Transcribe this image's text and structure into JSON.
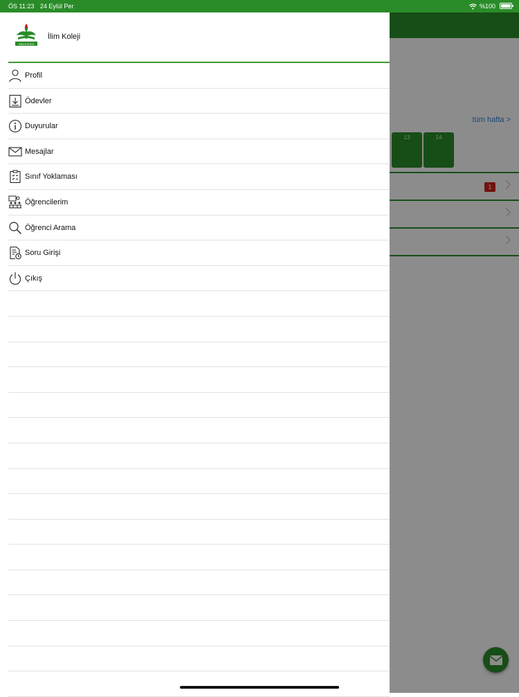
{
  "status_bar": {
    "time": "ÖS 11:23",
    "date": "24 Eylül Per",
    "battery": "%100"
  },
  "drawer": {
    "school_name": "İlim Koleji",
    "logo_text": "İLİM KOLEJİ",
    "menu": [
      {
        "label": "Profil",
        "icon": "person-icon"
      },
      {
        "label": "Ödevler",
        "icon": "download-icon"
      },
      {
        "label": "Duyurular",
        "icon": "info-icon"
      },
      {
        "label": "Mesajlar",
        "icon": "envelope-icon"
      },
      {
        "label": "Sınıf Yoklaması",
        "icon": "clipboard-icon"
      },
      {
        "label": "Öğrencilerim",
        "icon": "classroom-icon"
      },
      {
        "label": "Öğrenci Arama",
        "icon": "search-icon"
      },
      {
        "label": "Soru Girişi",
        "icon": "question-entry-icon"
      },
      {
        "label": "Çıkış",
        "icon": "power-icon"
      }
    ]
  },
  "background": {
    "week_link": "tüm hafta >",
    "days": [
      "13",
      "14"
    ],
    "badge_count": "1",
    "colors": {
      "brand": "#2a8c28",
      "link": "#2f7fd1",
      "badge": "#d0231a"
    }
  }
}
